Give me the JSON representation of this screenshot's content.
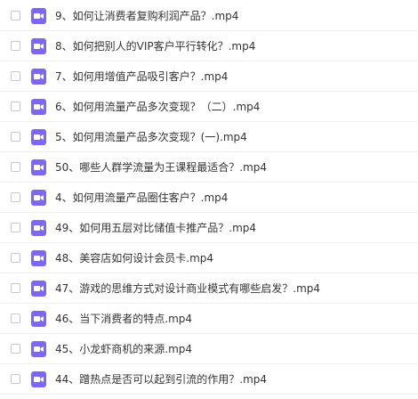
{
  "icon_color": "#7b68ee",
  "files": [
    {
      "name": "9、如何让消费者复购利润产品？.mp4",
      "icon": "video-file-icon"
    },
    {
      "name": "8、如何把别人的VIP客户平行转化？.mp4",
      "icon": "video-file-icon"
    },
    {
      "name": "7、如何用增值产品吸引客户？.mp4",
      "icon": "video-file-icon"
    },
    {
      "name": "6、如何用流量产品多次变现？（二）.mp4",
      "icon": "video-file-icon"
    },
    {
      "name": "5、如何用流量产品多次变现？(一).mp4",
      "icon": "video-file-icon"
    },
    {
      "name": "50、哪些人群学流量为王课程最适合？.mp4",
      "icon": "video-file-icon"
    },
    {
      "name": "4、如何用流量产品圈住客户？.mp4",
      "icon": "video-file-icon"
    },
    {
      "name": "49、如何用五层对比储值卡推产品？.mp4",
      "icon": "video-file-icon"
    },
    {
      "name": "48、美容店如何设计会员卡.mp4",
      "icon": "video-file-icon"
    },
    {
      "name": "47、游戏的思维方式对设计商业模式有哪些启发？.mp4",
      "icon": "video-file-icon"
    },
    {
      "name": "46、当下消费者的特点.mp4",
      "icon": "video-file-icon"
    },
    {
      "name": "45、小龙虾商机的来源.mp4",
      "icon": "video-file-icon"
    },
    {
      "name": "44、蹭热点是否可以起到引流的作用？.mp4",
      "icon": "video-file-icon"
    }
  ]
}
